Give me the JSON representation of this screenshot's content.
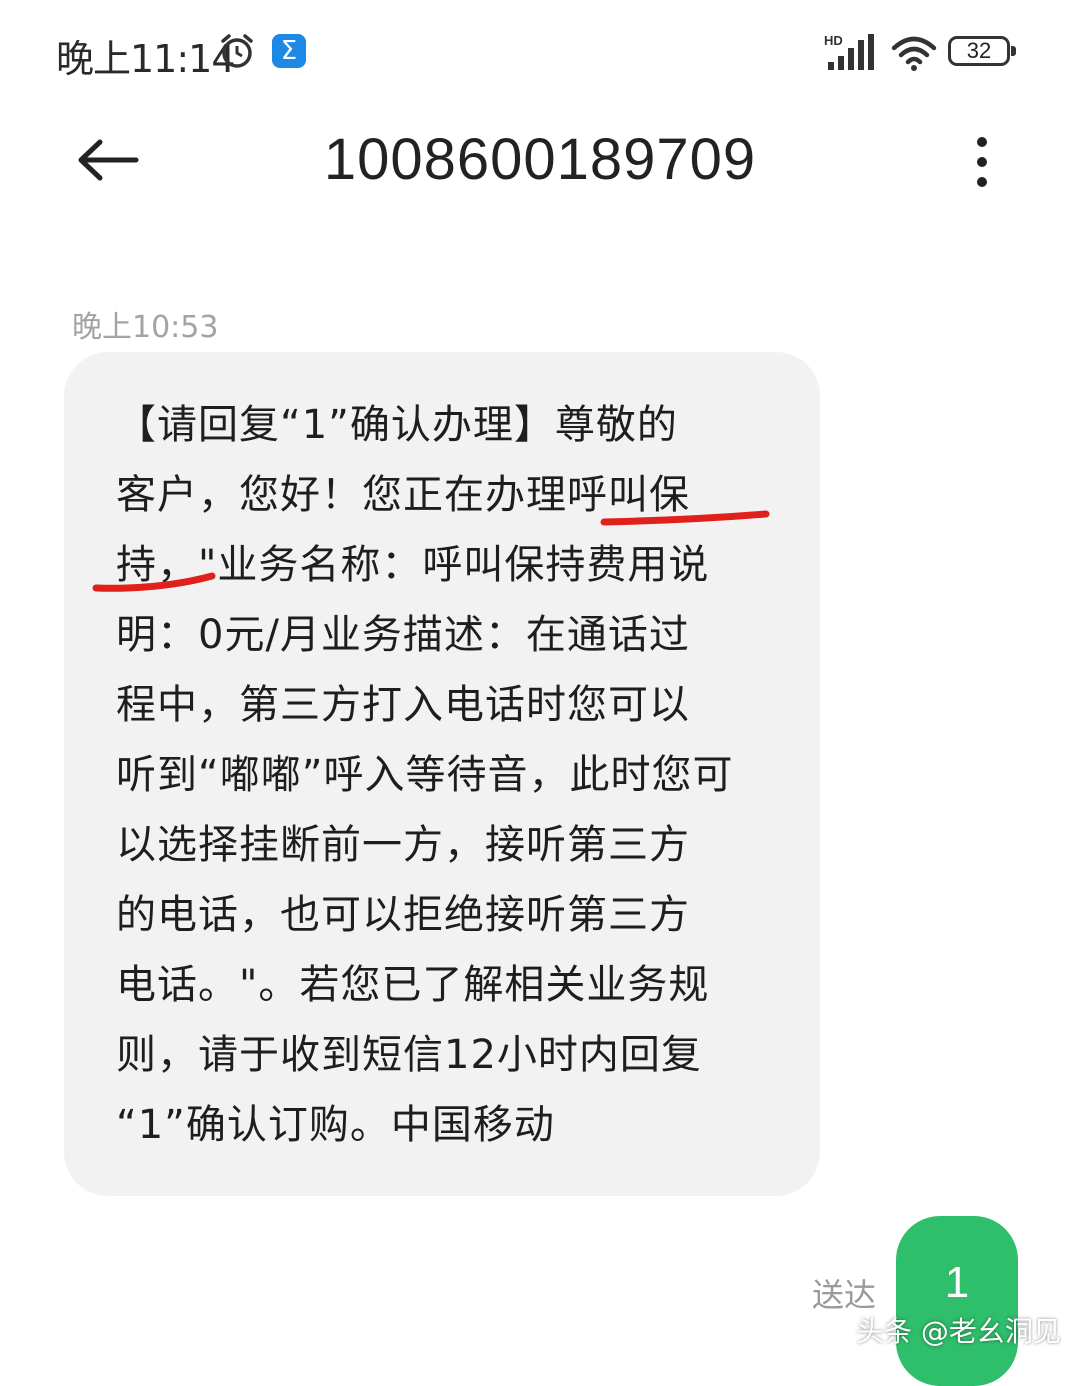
{
  "status_bar": {
    "time": "晚上11:14",
    "network": "HD",
    "battery": "32",
    "icons": [
      "alarm-icon",
      "app-icon",
      "signal-icon",
      "wifi-icon",
      "battery-icon"
    ]
  },
  "header": {
    "title": "1008600189709",
    "icons": [
      "back-arrow-icon",
      "more-vertical-icon"
    ]
  },
  "message": {
    "time": "晚上10:53",
    "lines": [
      "【请回复“1”确认办理】尊敬的",
      "客户，您好！您正在办理呼叫保",
      "持，\"业务名称：呼叫保持费用说",
      "明：0元/月业务描述：在通话过",
      "程中，第三方打入电话时您可以",
      "听到“嘟嘟”呼入等待音，此时您可",
      "以选择挂断前一方，接听第三方",
      "的电话，也可以拒绝接听第三方",
      "电话。\"。若您已了解相关业务规",
      "则，请于收到短信12小时内回复",
      "“1”确认订购。中国移动"
    ],
    "highlight_color": "#e0201a"
  },
  "reply": {
    "status": "送达",
    "text": "1",
    "bubble_color": "#2fbe6b"
  },
  "watermark": "头条 @老幺洞见"
}
